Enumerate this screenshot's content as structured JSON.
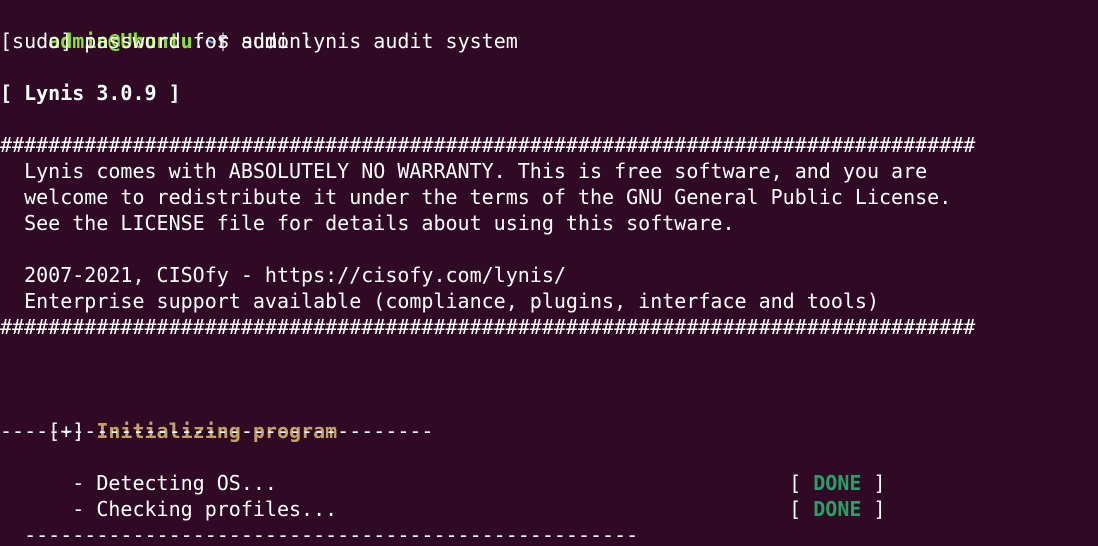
{
  "prompt": {
    "user_host": "admin@Ubuntu",
    "colon": ":",
    "path": "~",
    "dollar": "$",
    "command": " sudo lynis audit system"
  },
  "sudo_prompt": "[sudo] password for admin:",
  "banner": {
    "version": "[ Lynis 3.0.9 ]",
    "rule": "#################################################################################",
    "lines": [
      "  Lynis comes with ABSOLUTELY NO WARRANTY. This is free software, and you are",
      "  welcome to redistribute it under the terms of the GNU General Public License.",
      "  See the LICENSE file for details about using this software.",
      "",
      "  2007-2021, CISOfy - https://cisofy.com/lynis/",
      "  Enterprise support available (compliance, plugins, interface and tools)"
    ]
  },
  "section": {
    "marker": "[+] ",
    "title": "Initializing program",
    "divider": "------------------------------------"
  },
  "checks": [
    {
      "label": "  - Detecting OS...",
      "open": "[ ",
      "status": "DONE",
      "close": " ]"
    },
    {
      "label": "  - Checking profiles...",
      "open": "[ ",
      "status": "DONE",
      "close": " ]"
    }
  ],
  "bottom_divider": "  ---------------------------------------------------",
  "colors": {
    "background": "#300a24",
    "foreground": "#ffffff",
    "prompt_user": "#8ae234",
    "prompt_path": "#729fcf",
    "section_title": "#c4a06a",
    "status_done": "#26a269"
  }
}
